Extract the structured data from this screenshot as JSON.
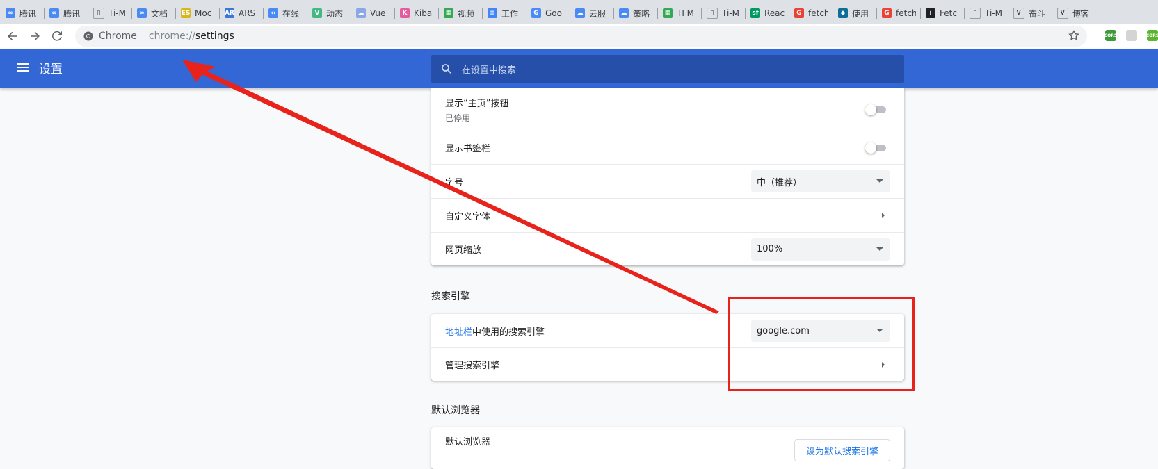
{
  "tabs": [
    {
      "label": "腾讯",
      "color": "#4a8af4",
      "glyph": "∞"
    },
    {
      "label": "腾讯",
      "color": "#4a8af4",
      "glyph": "∞"
    },
    {
      "label": "Ti-M",
      "color": "#ffffff",
      "glyph": "▯"
    },
    {
      "label": "文档",
      "color": "#4a8af4",
      "glyph": "∞"
    },
    {
      "label": "Moc",
      "color": "#d9b51a",
      "glyph": "ES"
    },
    {
      "label": "ARS",
      "color": "#3c78d8",
      "glyph": "AR"
    },
    {
      "label": "在线",
      "color": "#4a8af4",
      "glyph": "‹›"
    },
    {
      "label": "动态",
      "color": "#42b883",
      "glyph": "V"
    },
    {
      "label": "Vue",
      "color": "#8aa7e8",
      "glyph": "☁"
    },
    {
      "label": "Kiba",
      "color": "#e85aa0",
      "glyph": "K"
    },
    {
      "label": "视频",
      "color": "#34a853",
      "glyph": "▦"
    },
    {
      "label": "工作",
      "color": "#4285f4",
      "glyph": "≡"
    },
    {
      "label": "Goo",
      "color": "#4a8af4",
      "glyph": "G"
    },
    {
      "label": "云服",
      "color": "#4a8af4",
      "glyph": "☁"
    },
    {
      "label": "策略",
      "color": "#4a8af4",
      "glyph": "☁"
    },
    {
      "label": "TI M",
      "color": "#34a853",
      "glyph": "▦"
    },
    {
      "label": "Ti-M",
      "color": "#ffffff",
      "glyph": "▯"
    },
    {
      "label": "Reac",
      "color": "#009a61",
      "glyph": "sf"
    },
    {
      "label": "fetch",
      "color": "#ea4335",
      "glyph": "G"
    },
    {
      "label": "使用",
      "color": "#0d6e9a",
      "glyph": "◆"
    },
    {
      "label": "fetch",
      "color": "#ea4335",
      "glyph": "G"
    },
    {
      "label": "Fetc",
      "color": "#202124",
      "glyph": "i"
    },
    {
      "label": "Ti-M",
      "color": "#ffffff",
      "glyph": "▯"
    },
    {
      "label": "奋斗",
      "color": "#ffffff",
      "glyph": "Ꮩ"
    },
    {
      "label": "博客",
      "color": "#ffffff",
      "glyph": "Ꮩ"
    }
  ],
  "omnibox": {
    "chip": "Chrome",
    "scheme": "chrome://",
    "path": "settings"
  },
  "extensions": [
    {
      "label": "CORS",
      "color": "#3d9a39"
    },
    {
      "label": "",
      "color": "#d4d4d4"
    },
    {
      "label": "CORS",
      "color": "#5cb531"
    }
  ],
  "header": {
    "title": "设置",
    "search_placeholder": "在设置中搜索"
  },
  "appearance": {
    "home_button": {
      "label": "显示“主页”按钮",
      "sub": "已停用",
      "enabled": false
    },
    "bookmarks_bar": {
      "label": "显示书签栏",
      "enabled": false
    },
    "font_size": {
      "label": "字号",
      "value": "中（推荐）"
    },
    "custom_fonts": {
      "label": "自定义字体"
    },
    "page_zoom": {
      "label": "网页缩放",
      "value": "100%"
    }
  },
  "search_engine": {
    "title": "搜索引擎",
    "address_bar": {
      "link": "地址栏",
      "rest": "中使用的搜索引擎",
      "value": "google.com"
    },
    "manage": {
      "label": "管理搜索引擎"
    }
  },
  "default_browser": {
    "title": "默认浏览器",
    "row_label": "默认浏览器",
    "button": "设为默认搜索引擎"
  },
  "colors": {
    "header": "#3367d6",
    "annotation": "#e8231b",
    "link": "#1a73e8"
  }
}
